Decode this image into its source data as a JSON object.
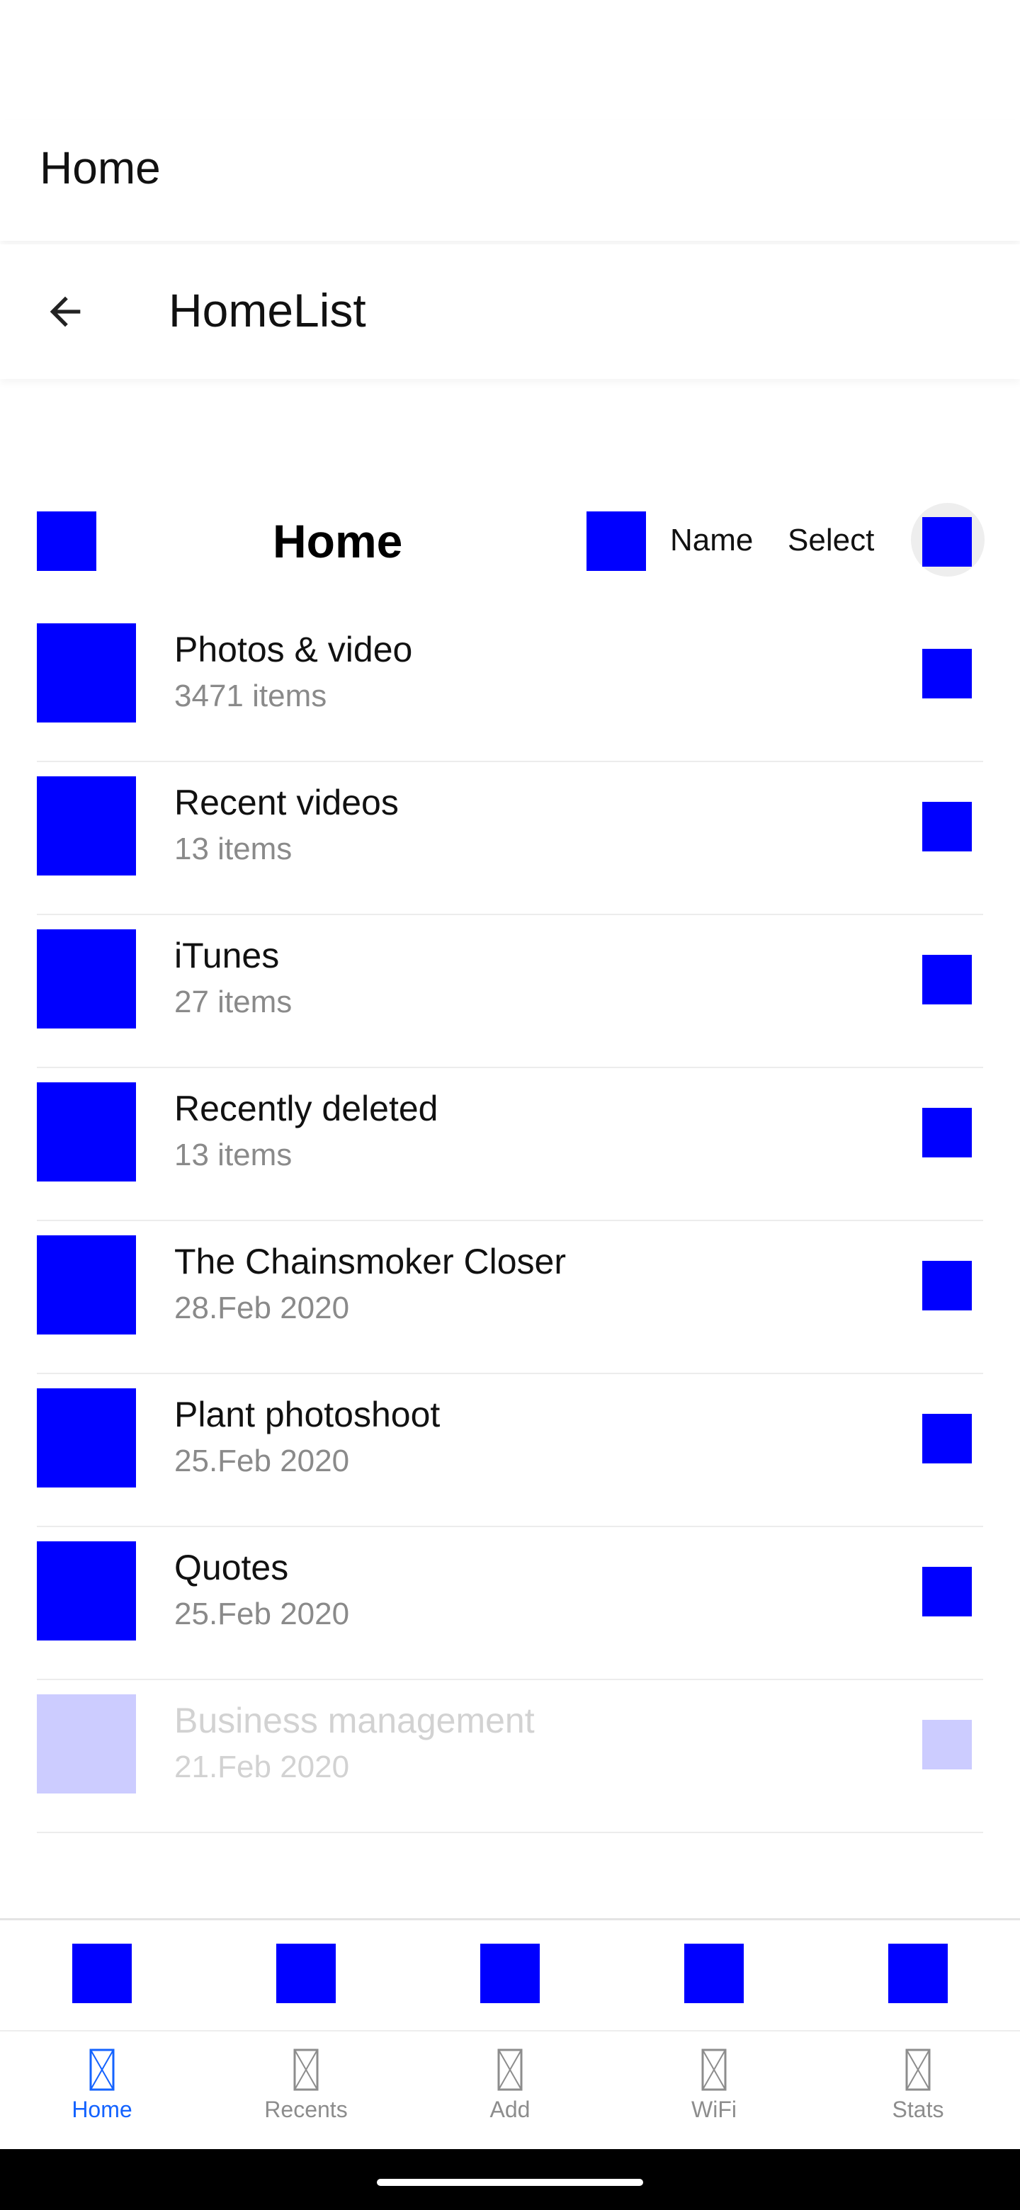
{
  "app_bar": {
    "title": "Home"
  },
  "toolbar": {
    "title": "HomeList"
  },
  "list_header": {
    "title": "Home",
    "sort_label": "Name",
    "select_label": "Select"
  },
  "items": [
    {
      "title": "Photos & video",
      "subtitle": "3471 items"
    },
    {
      "title": "Recent videos",
      "subtitle": "13 items"
    },
    {
      "title": "iTunes",
      "subtitle": "27 items"
    },
    {
      "title": "Recently deleted",
      "subtitle": "13 items"
    },
    {
      "title": "The Chainsmoker Closer",
      "subtitle": "28.Feb 2020"
    },
    {
      "title": "Plant photoshoot",
      "subtitle": "25.Feb 2020"
    },
    {
      "title": "Quotes",
      "subtitle": "25.Feb 2020"
    },
    {
      "title": "Business management",
      "subtitle": "21.Feb 2020"
    }
  ],
  "tabs": [
    {
      "label": "Home",
      "active": true
    },
    {
      "label": "Recents",
      "active": false
    },
    {
      "label": "Add",
      "active": false
    },
    {
      "label": "WiFi",
      "active": false
    },
    {
      "label": "Stats",
      "active": false
    }
  ],
  "colors": {
    "placeholder_blue": "#0000ff",
    "active_tab": "#1463ff",
    "muted_text": "#8a8a8a"
  }
}
